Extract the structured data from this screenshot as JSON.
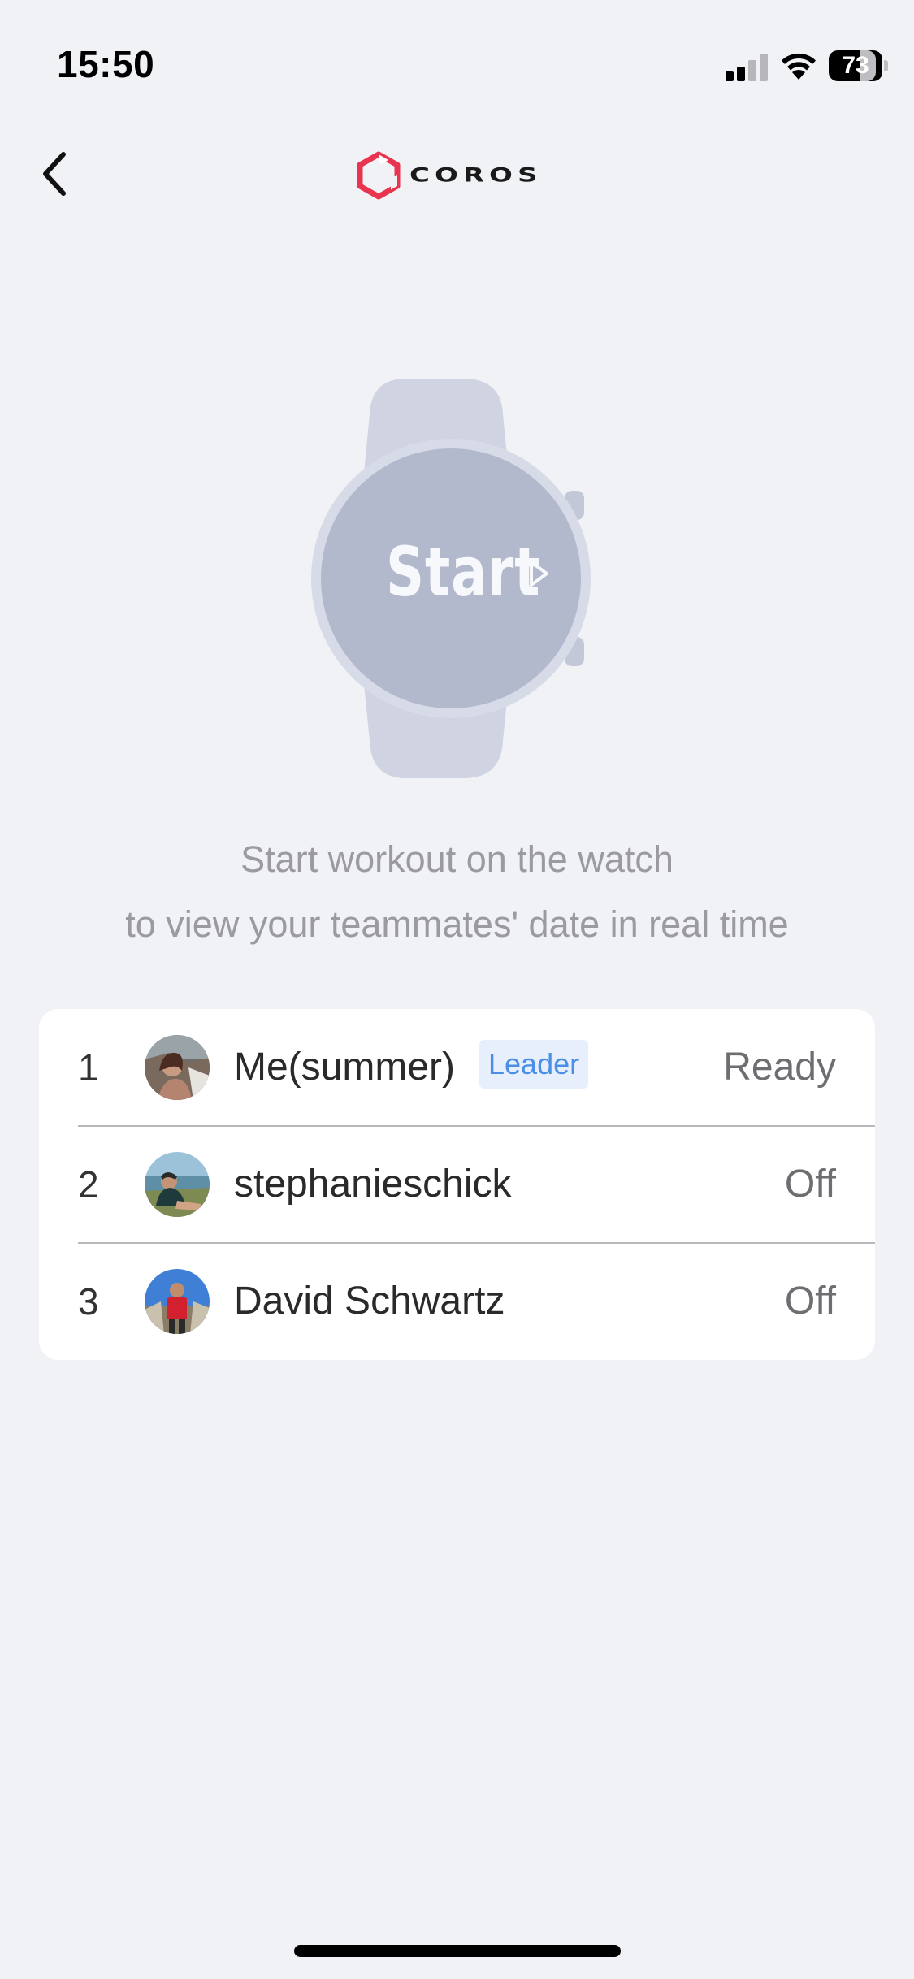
{
  "status_bar": {
    "time": "15:50",
    "battery": "73"
  },
  "header": {
    "back_icon": "chevron-left-icon",
    "logo_text": "COROS",
    "logo_color": "#e8344e"
  },
  "watch": {
    "button_label": "Start"
  },
  "instructions": {
    "line1": "Start workout on the watch",
    "line2": "to view your teammates' date in real time"
  },
  "team": {
    "members": [
      {
        "rank": "1",
        "name": "Me(summer)",
        "badge": "Leader",
        "status": "Ready"
      },
      {
        "rank": "2",
        "name": "stephanieschick",
        "status": "Off"
      },
      {
        "rank": "3",
        "name": "David Schwartz",
        "status": "Off"
      }
    ]
  },
  "colors": {
    "background": "#f1f2f6",
    "badge_text": "#4a8ee8",
    "badge_bg": "#e6effb"
  }
}
